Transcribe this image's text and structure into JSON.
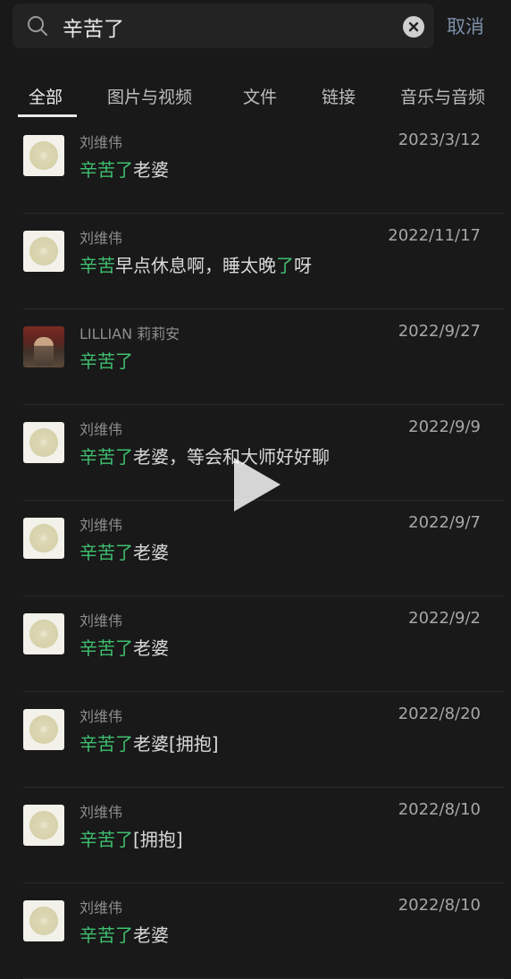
{
  "search": {
    "query": "辛苦了",
    "cancel_label": "取消"
  },
  "tabs": [
    {
      "label": "全部"
    },
    {
      "label": "图片与视频"
    },
    {
      "label": "文件"
    },
    {
      "label": "链接"
    },
    {
      "label": "音乐与音频"
    }
  ],
  "results": [
    {
      "sender": "刘维伟",
      "date": "2023/3/12",
      "avatar": "disc-icon",
      "segments": [
        {
          "text": "辛苦了",
          "highlight": true
        },
        {
          "text": "老婆",
          "highlight": false
        }
      ]
    },
    {
      "sender": "刘维伟",
      "date": "2022/11/17",
      "avatar": "disc-icon",
      "segments": [
        {
          "text": "辛苦",
          "highlight": true
        },
        {
          "text": "早点休息啊，睡太晚",
          "highlight": false
        },
        {
          "text": "了",
          "highlight": true
        },
        {
          "text": "呀",
          "highlight": false
        }
      ]
    },
    {
      "sender": "LILLIAN 莉莉安",
      "date": "2022/9/27",
      "avatar": "photo",
      "segments": [
        {
          "text": "辛苦了",
          "highlight": true
        }
      ]
    },
    {
      "sender": "刘维伟",
      "date": "2022/9/9",
      "avatar": "disc-icon",
      "segments": [
        {
          "text": "辛苦了",
          "highlight": true
        },
        {
          "text": "老婆，等会和大师好好聊",
          "highlight": false
        }
      ]
    },
    {
      "sender": "刘维伟",
      "date": "2022/9/7",
      "avatar": "disc-icon",
      "segments": [
        {
          "text": "辛苦了",
          "highlight": true
        },
        {
          "text": "老婆",
          "highlight": false
        }
      ]
    },
    {
      "sender": "刘维伟",
      "date": "2022/9/2",
      "avatar": "disc-icon",
      "segments": [
        {
          "text": "辛苦了",
          "highlight": true
        },
        {
          "text": "老婆",
          "highlight": false
        }
      ]
    },
    {
      "sender": "刘维伟",
      "date": "2022/8/20",
      "avatar": "disc-icon",
      "segments": [
        {
          "text": "辛苦了",
          "highlight": true
        },
        {
          "text": "老婆[拥抱]",
          "highlight": false
        }
      ]
    },
    {
      "sender": "刘维伟",
      "date": "2022/8/10",
      "avatar": "disc-icon",
      "segments": [
        {
          "text": "辛苦了",
          "highlight": true
        },
        {
          "text": "[拥抱]",
          "highlight": false
        }
      ]
    },
    {
      "sender": "刘维伟",
      "date": "2022/8/10",
      "avatar": "disc-icon",
      "segments": [
        {
          "text": "辛苦了",
          "highlight": true
        },
        {
          "text": "老婆",
          "highlight": false
        }
      ]
    }
  ],
  "colors": {
    "highlight": "#3fbf6f",
    "background": "#191919",
    "cancel": "#7d90a9"
  }
}
